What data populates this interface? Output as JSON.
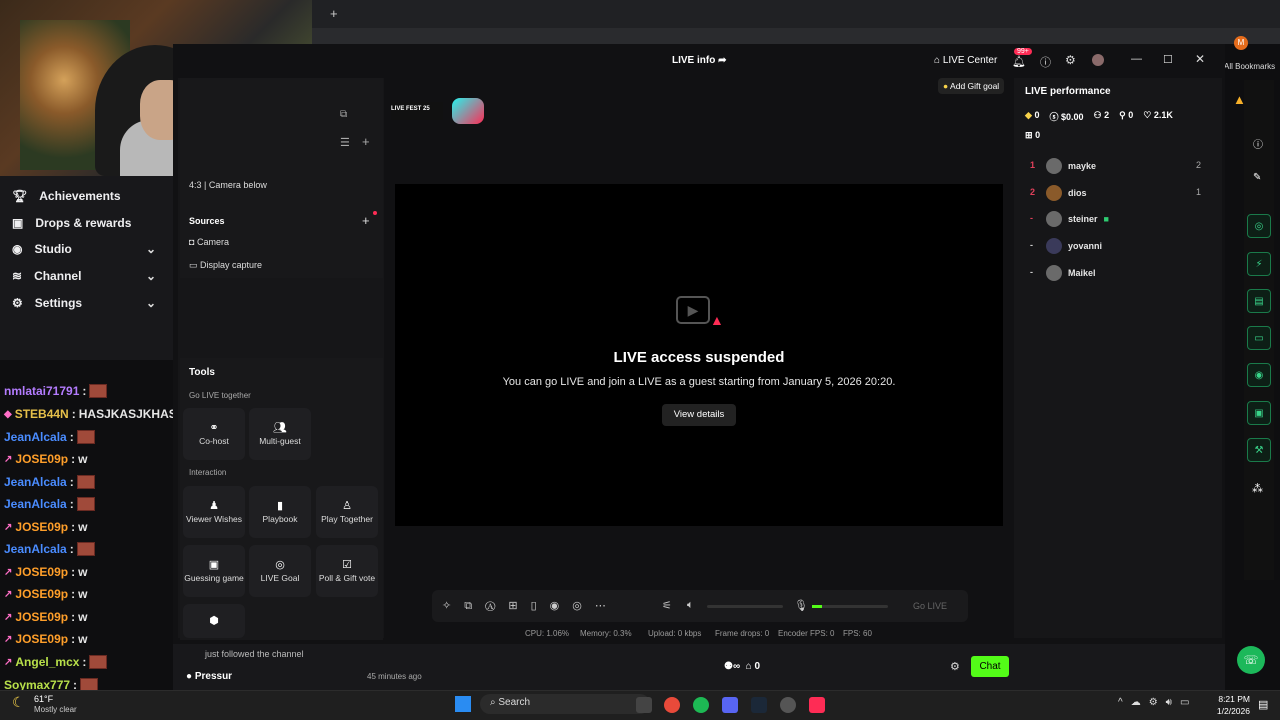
{
  "browser": {
    "bookmarks_label": "All Bookmarks",
    "new_tab": "+"
  },
  "left_nav": {
    "items": [
      {
        "label": "Achievements",
        "icon": "trophy-icon"
      },
      {
        "label": "Drops & rewards",
        "icon": "gift-icon"
      },
      {
        "label": "Studio",
        "icon": "studio-icon"
      },
      {
        "label": "Channel",
        "icon": "channel-icon"
      },
      {
        "label": "Settings",
        "icon": "gear-icon"
      }
    ]
  },
  "chat": {
    "lines": [
      {
        "user": "nmlatai71791",
        "msg": "",
        "color": "#b47cff"
      },
      {
        "user": "STEB44N",
        "msg": "HASJKASJKHASJK",
        "color": "#e6c04a"
      },
      {
        "user": "JeanAlcala",
        "msg": "",
        "color": "#4a8cff"
      },
      {
        "user": "JOSE09p",
        "msg": "w",
        "color": "#ff9f2a"
      },
      {
        "user": "JeanAlcala",
        "msg": "",
        "color": "#4a8cff"
      },
      {
        "user": "JeanAlcala",
        "msg": "",
        "color": "#4a8cff"
      },
      {
        "user": "JOSE09p",
        "msg": "w",
        "color": "#ff9f2a"
      },
      {
        "user": "JeanAlcala",
        "msg": "",
        "color": "#4a8cff"
      },
      {
        "user": "JOSE09p",
        "msg": "w",
        "color": "#ff9f2a"
      },
      {
        "user": "JOSE09p",
        "msg": "w",
        "color": "#ff9f2a"
      },
      {
        "user": "JOSE09p",
        "msg": "w",
        "color": "#ff9f2a"
      },
      {
        "user": "JOSE09p",
        "msg": "w",
        "color": "#ff9f2a"
      },
      {
        "user": "Angel_mcx",
        "msg": "",
        "color": "#b8e04a"
      },
      {
        "user": "Soymax777",
        "msg": "",
        "color": "#b8e04a"
      }
    ]
  },
  "studio": {
    "title": "LIVE info",
    "live_center": "LIVE Center",
    "notif_badge": "99+",
    "add_gift_goal": "Add Gift goal",
    "fest_label": "LIVE FEST 25",
    "layout_label": "4:3 | Camera below",
    "sources_title": "Sources",
    "sources": [
      "Camera",
      "Display capture"
    ],
    "tools_title": "Tools",
    "go_live_together": "Go LIVE together",
    "together_tools": [
      "Co-host",
      "Multi-guest"
    ],
    "interaction": "Interaction",
    "interaction_tools": [
      "Viewer Wishes",
      "Playbook",
      "Play Together",
      "Guessing game",
      "LIVE Goal",
      "Poll & Gift vote"
    ],
    "preview": {
      "title": "LIVE access suspended",
      "message": "You can go LIVE and join a LIVE as a guest starting from January 5, 2026 20:20.",
      "button": "View details"
    },
    "go_live": "Go LIVE",
    "status": {
      "cpu": "CPU: 1.06%",
      "memory": "Memory: 0.3%",
      "upload": "Upload: 0 kbps",
      "frame_drops": "Frame drops: 0",
      "encoder_fps": "Encoder FPS: 0",
      "fps": "FPS: 60"
    }
  },
  "performance": {
    "title": "LIVE performance",
    "stats": {
      "diamonds": "0",
      "earnings": "$0.00",
      "viewers": "2",
      "new_followers": "0",
      "likes": "2.1K",
      "gifts": "0"
    },
    "viewers": [
      {
        "rank": "1",
        "name": "mayke",
        "score": "2"
      },
      {
        "rank": "2",
        "name": "dios",
        "score": "1"
      },
      {
        "rank": "-",
        "name": "steiner",
        "score": ""
      },
      {
        "rank": "-",
        "name": "yovanni",
        "score": ""
      },
      {
        "rank": "-",
        "name": "Maikel",
        "score": ""
      }
    ]
  },
  "twitch_bottom": {
    "followed_text": "just followed the channel",
    "user": "Pressur",
    "time": "45 minutes ago",
    "counter": "0",
    "chat_button": "Chat"
  },
  "taskbar": {
    "temp": "61°F",
    "weather": "Mostly clear",
    "search": "Search",
    "time": "8:21 PM",
    "date": "1/2/2026"
  },
  "colors": {
    "accent": "#53fc18",
    "tiktok_red": "#fe2c55"
  }
}
